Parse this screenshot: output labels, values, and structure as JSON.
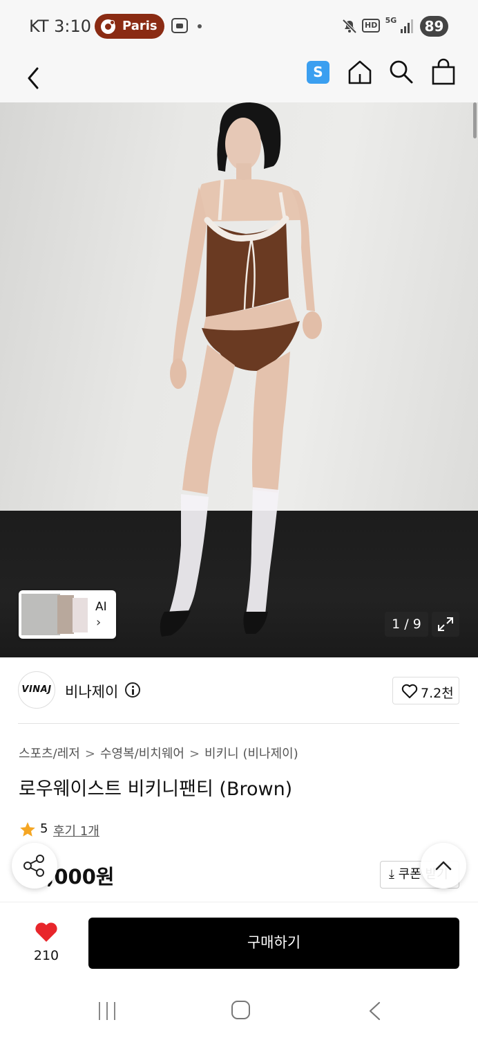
{
  "status_bar": {
    "carrier_time": "KT 3:10",
    "live_activity": "Paris",
    "battery": "89",
    "network_hd": "HD",
    "network_5g": "5G"
  },
  "nav": {
    "badge_letter": "S",
    "icons": [
      "back-icon",
      "s-app-icon",
      "home-icon",
      "search-icon",
      "shopping-bag-icon"
    ]
  },
  "hero": {
    "thumbnail_label": "AI",
    "page_counter": "1 / 9"
  },
  "brand": {
    "logo_text": "VINAJ",
    "name": "비나제이",
    "likes": "7.2천"
  },
  "product": {
    "breadcrumb": [
      "스포츠/레저",
      "수영복/비치웨어",
      "비키니 (비나제이)"
    ],
    "breadcrumb_separator": ">",
    "title": "로우웨이스트 비키니팬티 (Brown)",
    "rating": "5",
    "review_link": "후기 1개",
    "price": "45,000원",
    "coupon_label": "쿠폰 받기"
  },
  "bottom_bar": {
    "like_count": "210",
    "buy_label": "구매하기",
    "heart_color": "#e8262b"
  },
  "colors": {
    "accent_badge": "#3b9ff0",
    "live_pill": "#8a2b13",
    "star": "#f5a623",
    "buy_button": "#000000"
  }
}
